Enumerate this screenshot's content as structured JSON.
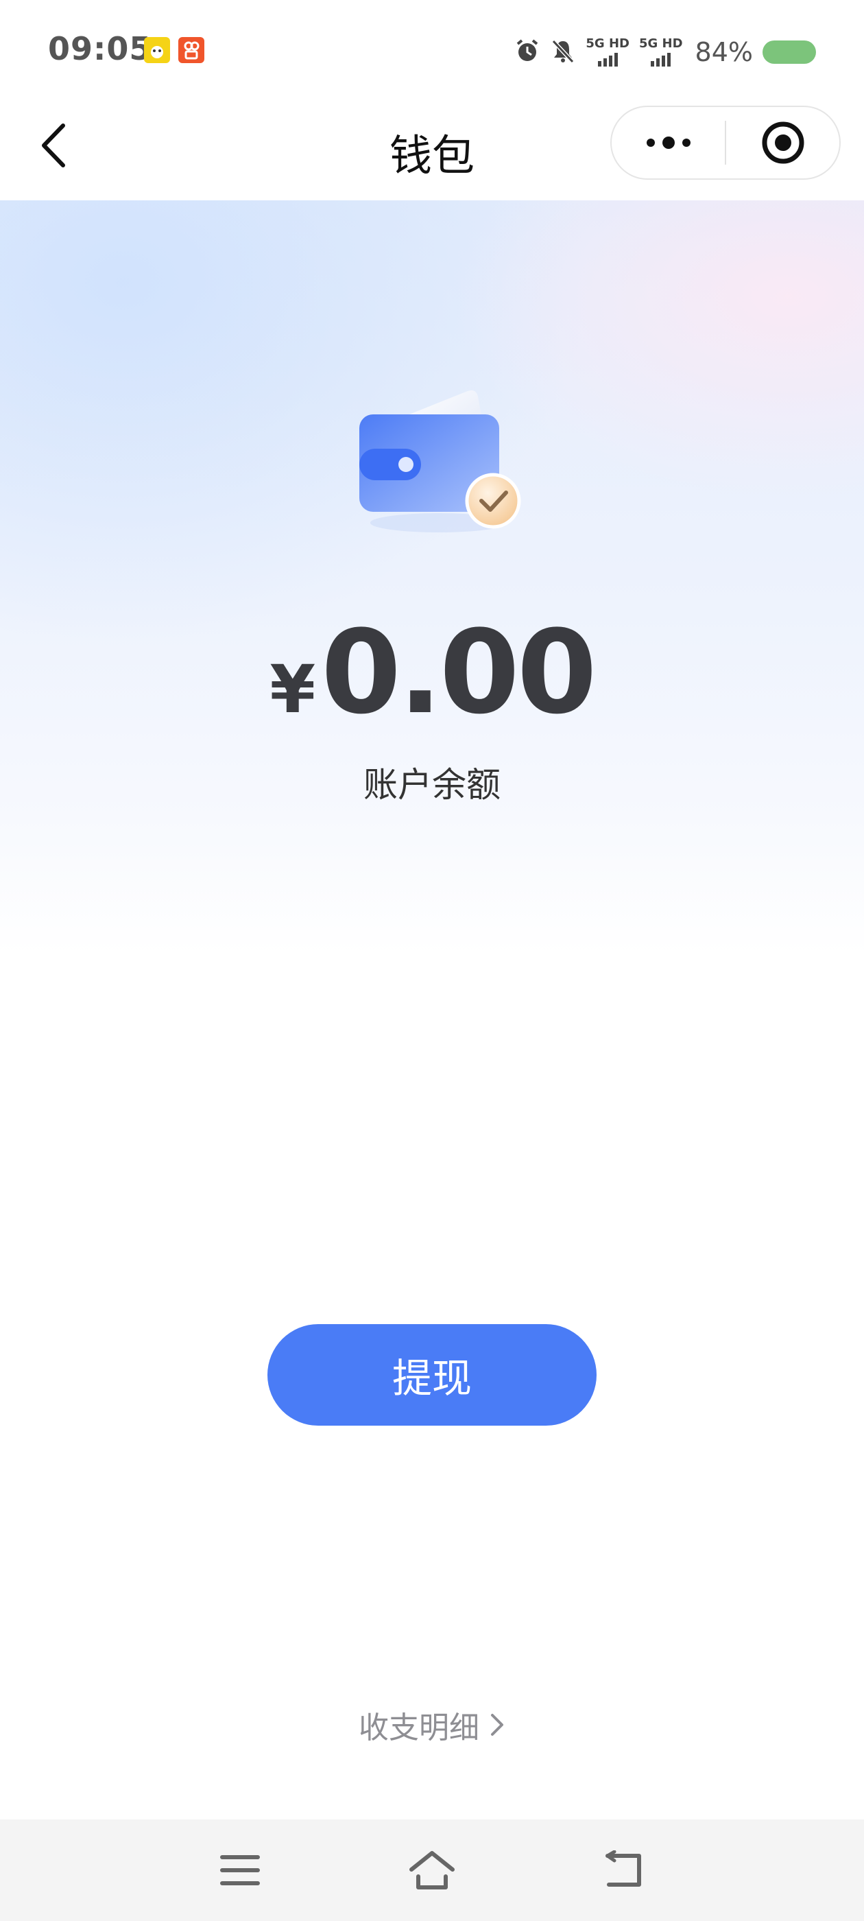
{
  "status_bar": {
    "time": "09:05",
    "sim1_label": "5G HD",
    "sim2_label": "5G HD",
    "battery_percent": "84%",
    "battery_color": "#7cc47b",
    "app_badges": [
      "yellow-app-icon",
      "orange-app-icon"
    ],
    "icons": [
      "alarm-icon",
      "mute-bell-icon",
      "signal-icon",
      "signal-icon",
      "battery-icon"
    ]
  },
  "nav": {
    "title": "钱包",
    "back_icon": "chevron-left-icon",
    "more_icon": "more-dots-icon",
    "close_icon": "target-circle-icon"
  },
  "wallet": {
    "currency_symbol": "¥",
    "balance": "0.00",
    "balance_label": "账户余额",
    "withdraw_label": "提现",
    "details_label": "收支明细",
    "accent_color": "#4a7cf6"
  },
  "system_nav": {
    "icons": [
      "menu-icon",
      "home-icon",
      "back-icon"
    ]
  }
}
